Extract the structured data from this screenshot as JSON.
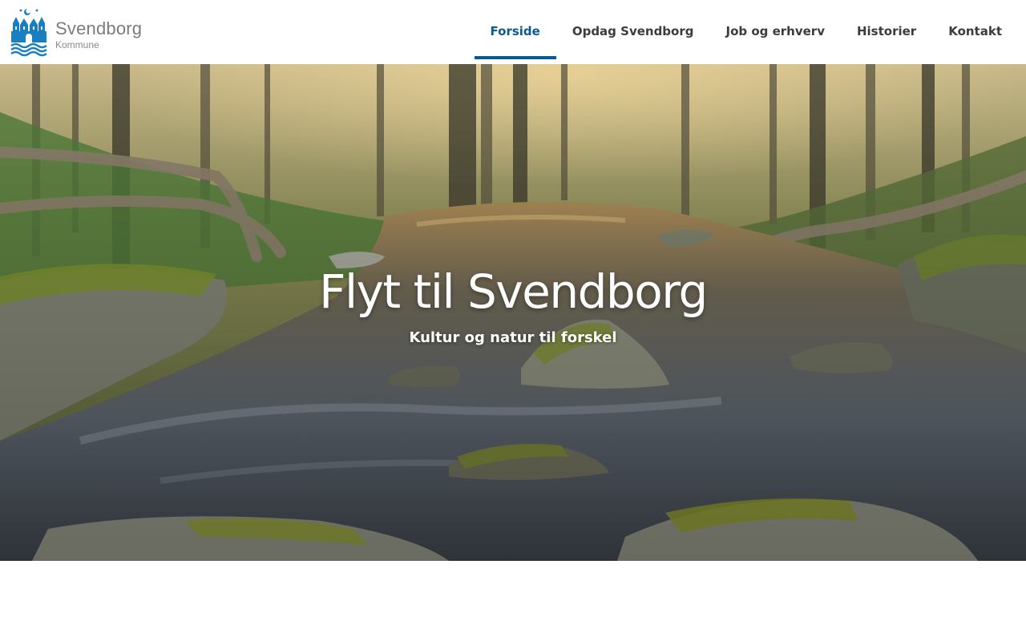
{
  "header": {
    "logo": {
      "name": "Svendborg",
      "sub": "Kommune",
      "icon": "svendborg-coat-of-arms-icon",
      "color": "#1a7fc1"
    },
    "nav": [
      {
        "label": "Forside",
        "active": true
      },
      {
        "label": "Opdag Svendborg",
        "active": false
      },
      {
        "label": "Job og erhverv",
        "active": false
      },
      {
        "label": "Historier",
        "active": false
      },
      {
        "label": "Kontakt",
        "active": false
      }
    ],
    "accent_color": "#0e5a8f"
  },
  "hero": {
    "title": "Flyt til Svendborg",
    "subtitle": "Kultur og natur til forskel",
    "background": "forest-stream-photo"
  }
}
